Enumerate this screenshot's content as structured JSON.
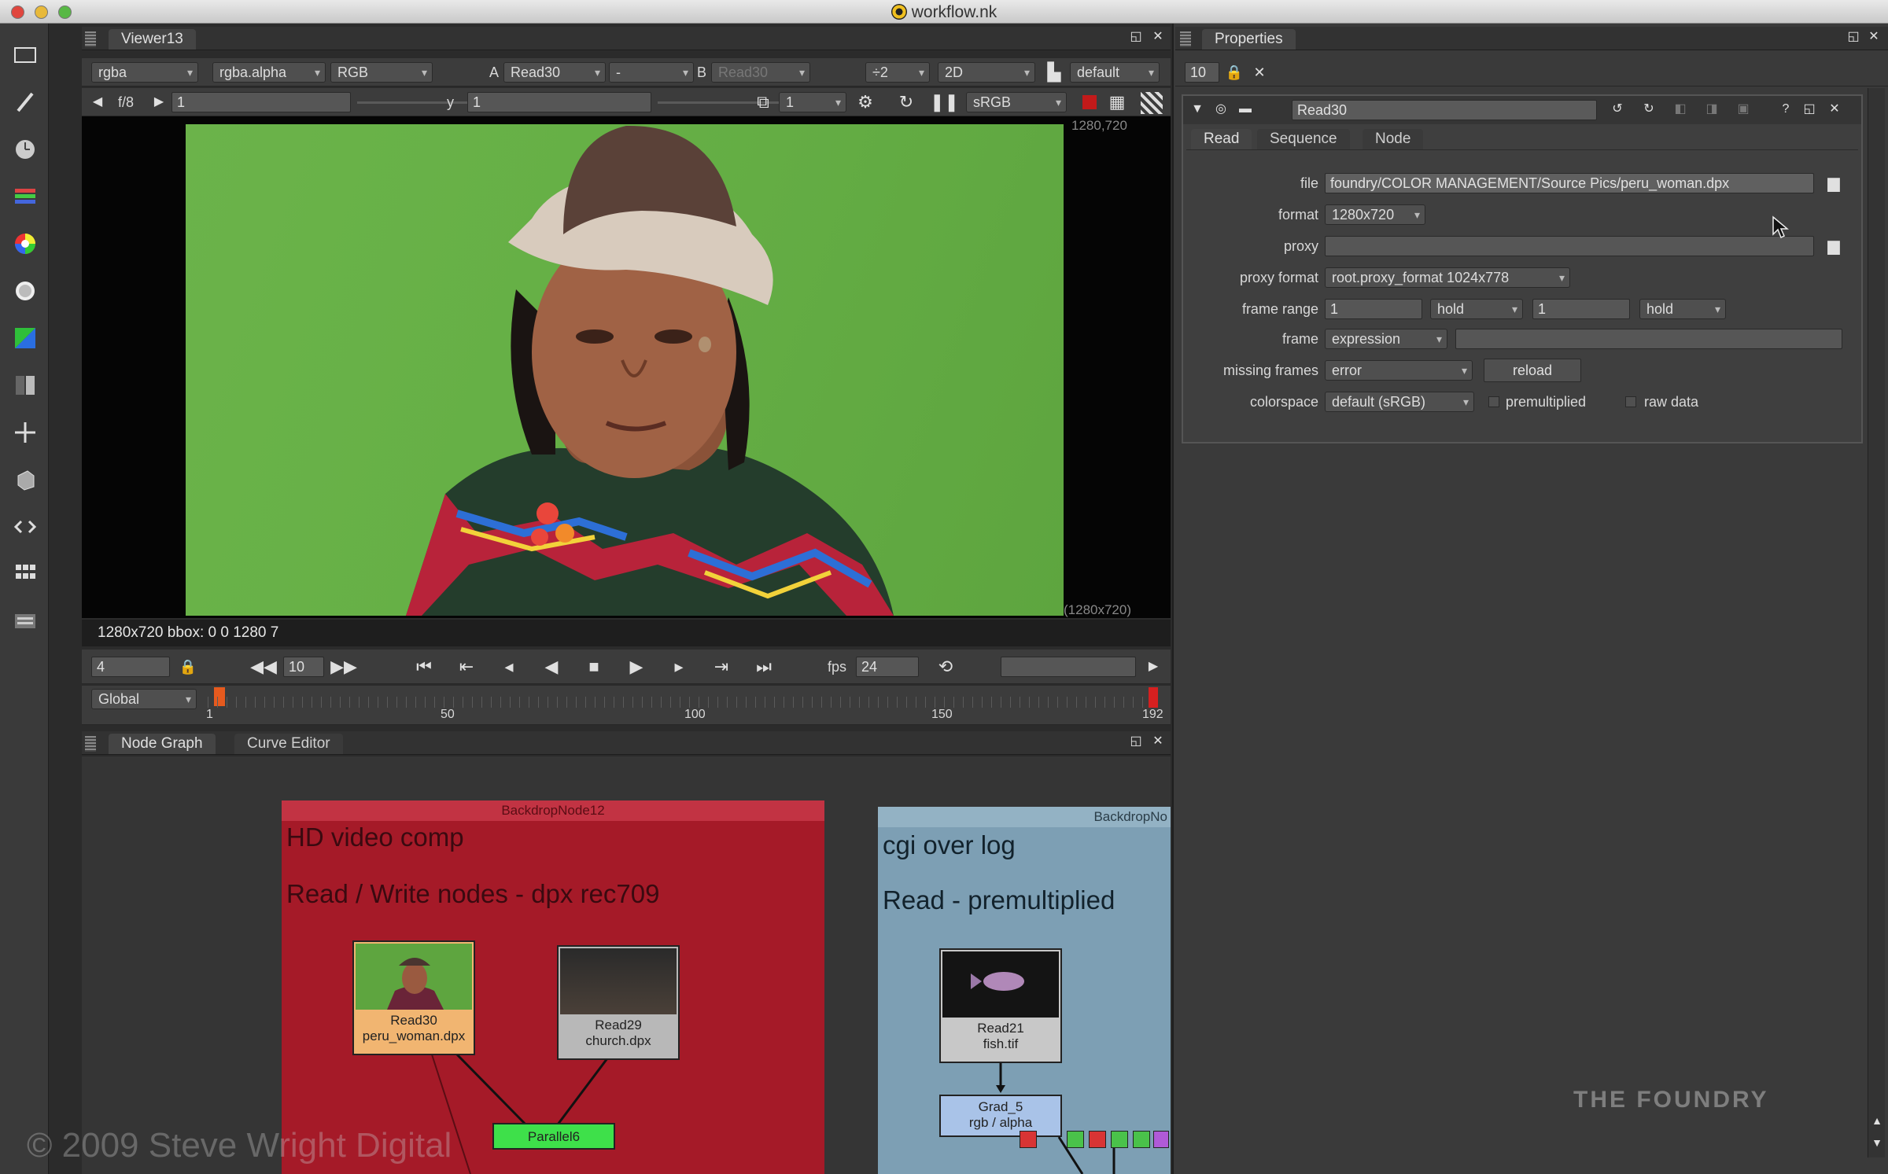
{
  "window": {
    "title": "workflow.nk"
  },
  "toolbar": {
    "tools": [
      "image-tool-icon",
      "brush-tool-icon",
      "clock-tool-icon",
      "channel-tool-icon",
      "color-wheel-icon",
      "filter-tool-icon",
      "keyer-tool-icon",
      "merge-tool-icon",
      "transform-tool-icon",
      "3d-tool-icon",
      "views-tool-icon",
      "metadata-tool-icon",
      "other-tool-icon"
    ]
  },
  "viewer": {
    "tab": "Viewer13",
    "channels": "rgba",
    "alpha": "rgba.alpha",
    "display": "RGB",
    "a_label": "A",
    "a_input": "Read30",
    "compare": "-",
    "b_label": "B",
    "b_input": "Read30",
    "downscale": "÷2",
    "mode": "2D",
    "lut_default": "default",
    "fstop": "f/8",
    "gain": "1",
    "y_label": "y",
    "gamma": "1",
    "proxy_num": "1",
    "colorspace": "sRGB",
    "res_top": "1280,720",
    "res_bottom": "(1280x720)",
    "info": "1280x720 bbox: 0 0 1280 7",
    "frame_field": "4",
    "step": "10",
    "fps_label": "fps",
    "fps": "24",
    "timeline_mode": "Global",
    "ticks": [
      "1",
      "50",
      "100",
      "150",
      "192"
    ]
  },
  "nodegraph": {
    "tabs": [
      "Node Graph",
      "Curve Editor"
    ],
    "backdrop1": {
      "title": "BackdropNode12",
      "line1": "HD video comp",
      "line2": "Read / Write nodes -  dpx   rec709"
    },
    "backdrop2": {
      "title": "BackdropNo",
      "line1": "cgi over log",
      "line2": "Read  - premultiplied"
    },
    "nodes": {
      "read30": {
        "name": "Read30",
        "file": "peru_woman.dpx"
      },
      "read29": {
        "name": "Read29",
        "file": "church.dpx"
      },
      "read21": {
        "name": "Read21",
        "file": "fish.tif"
      },
      "grad": {
        "name": "Grad_5",
        "sub": "rgb / alpha"
      },
      "parallel": {
        "name": "Parallel6"
      }
    },
    "watermark": "© 2009 Steve Wright Digital",
    "brand": "THE FOUNDRY"
  },
  "properties": {
    "tab": "Properties",
    "max_panels": "10",
    "node_name": "Read30",
    "tabs": [
      "Read",
      "Sequence",
      "Node"
    ],
    "file_label": "file",
    "file_value": "foundry/COLOR MANAGEMENT/Source Pics/peru_woman.dpx",
    "format_label": "format",
    "format_value": "1280x720",
    "proxy_label": "proxy",
    "proxy_value": "",
    "proxy_format_label": "proxy format",
    "proxy_format_value": "root.proxy_format 1024x778",
    "frame_range_label": "frame range",
    "range_start": "1",
    "before": "hold",
    "range_end": "1",
    "after": "hold",
    "frame_label": "frame",
    "frame_mode": "expression",
    "missing_label": "missing frames",
    "missing_value": "error",
    "reload": "reload",
    "colorspace_label": "colorspace",
    "colorspace_value": "default (sRGB)",
    "premultiplied": "premultiplied",
    "raw_data": "raw data"
  }
}
